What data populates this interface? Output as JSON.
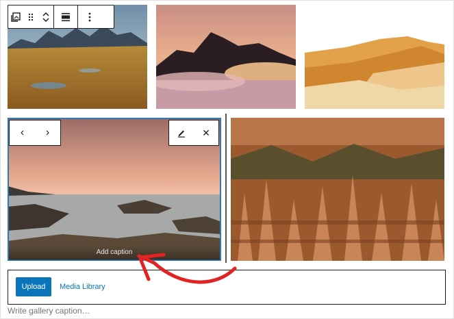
{
  "toolbar": {
    "change_type_icon": "gallery-icon",
    "drag_icon": "drag-handle-icon",
    "move_icons": [
      "chevron-up-icon",
      "chevron-down-icon"
    ],
    "align_icon": "align-wide-icon",
    "options_icon": "more-vertical-icon"
  },
  "selected_image": {
    "nav": [
      "‹",
      "›"
    ],
    "edit_icon": "pencil-icon",
    "remove_label": "✕",
    "caption_placeholder": "Add caption"
  },
  "upload": {
    "button_label": "Upload",
    "media_library_label": "Media Library"
  },
  "gallery_caption_placeholder": "Write gallery caption…",
  "colors": {
    "selection": "#2e7ab8",
    "primary": "#0a74b8",
    "annotation_arrow": "#e02424"
  }
}
